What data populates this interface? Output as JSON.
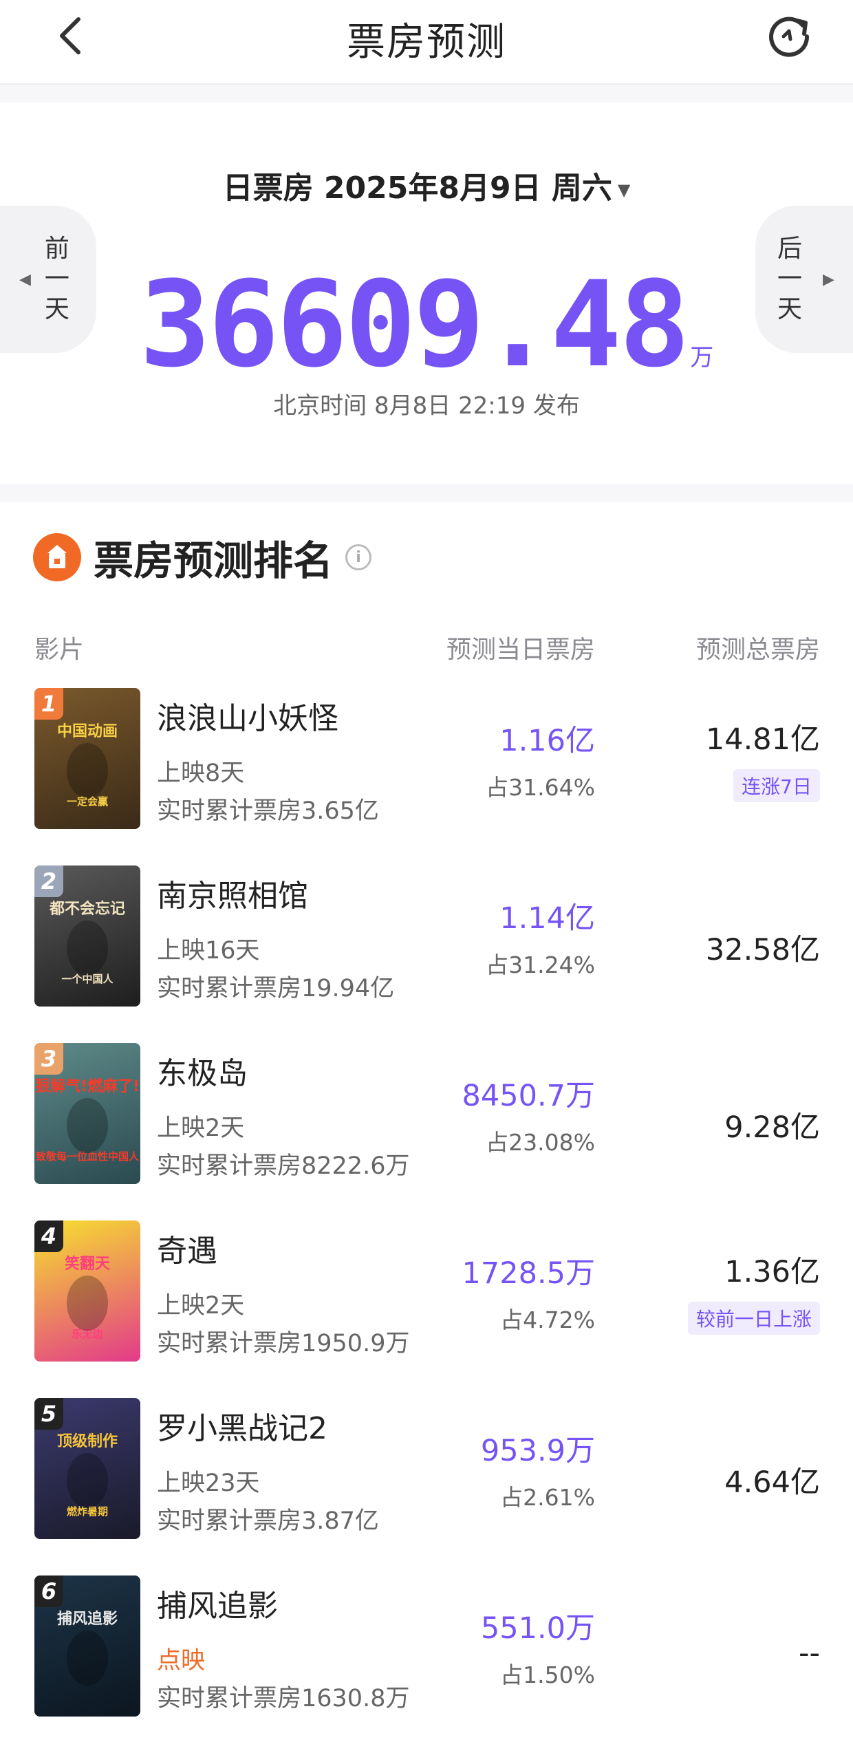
{
  "header": {
    "title": "票房预测",
    "back_icon": "chevron-left-icon",
    "refresh_icon": "refresh-icon"
  },
  "daily": {
    "date_label": "日票房 2025年8月9日 周六",
    "prev_label": [
      "前",
      "一",
      "天"
    ],
    "next_label": [
      "后",
      "一",
      "天"
    ],
    "value": "36609.48",
    "unit": "万",
    "published": "北京时间 8月8日 22:19 发布"
  },
  "ranking": {
    "title": "票房预测排名",
    "col_film": "影片",
    "col_day": "预测当日票房",
    "col_total": "预测总票房",
    "movies": [
      {
        "rank": "1",
        "name": "浪浪山小妖怪",
        "days": "上映8天",
        "cumulative": "实时累计票房3.65亿",
        "day_value": "1.16亿",
        "share": "占31.64%",
        "total": "14.81亿",
        "tag": "连涨7日",
        "badge_color": "#f07a3a",
        "poster_lines": [
          "中国动画",
          "一定会赢"
        ],
        "poster_colors": [
          "#7b5a2c",
          "#3a2a18"
        ],
        "poster_text_color": "#f7d046"
      },
      {
        "rank": "2",
        "name": "南京照相馆",
        "days": "上映16天",
        "cumulative": "实时累计票房19.94亿",
        "day_value": "1.14亿",
        "share": "占31.24%",
        "total": "32.58亿",
        "tag": "",
        "badge_color": "#9aa6b8",
        "poster_lines": [
          "都不会忘记",
          "一个中国人"
        ],
        "poster_colors": [
          "#5a5a5a",
          "#1e1e1e"
        ],
        "poster_text_color": "#f3e4c0"
      },
      {
        "rank": "3",
        "name": "东极岛",
        "days": "上映2天",
        "cumulative": "实时累计票房8222.6万",
        "day_value": "8450.7万",
        "share": "占23.08%",
        "total": "9.28亿",
        "tag": "",
        "badge_color": "#e8a26a",
        "poster_lines": [
          "狠解气!燃麻了!",
          "致敬每一位血性中国人"
        ],
        "poster_colors": [
          "#5f8a8a",
          "#2a4a4f"
        ],
        "poster_text_color": "#f53b2a"
      },
      {
        "rank": "4",
        "name": "奇遇",
        "days": "上映2天",
        "cumulative": "实时累计票房1950.9万",
        "day_value": "1728.5万",
        "share": "占4.72%",
        "total": "1.36亿",
        "tag": "较前一日上涨",
        "badge_color": "#222222",
        "poster_lines": [
          "笑翻天",
          "乐无边"
        ],
        "poster_colors": [
          "#f7e12e",
          "#e23a8a"
        ],
        "poster_text_color": "#ff3d7f"
      },
      {
        "rank": "5",
        "name": "罗小黑战记2",
        "days": "上映23天",
        "cumulative": "实时累计票房3.87亿",
        "day_value": "953.9万",
        "share": "占2.61%",
        "total": "4.64亿",
        "tag": "",
        "badge_color": "#222222",
        "poster_lines": [
          "顶级制作",
          "燃炸暑期"
        ],
        "poster_colors": [
          "#3c3a6e",
          "#1a1a2a"
        ],
        "poster_text_color": "#f5c53a"
      },
      {
        "rank": "6",
        "name": "捕风追影",
        "days": "点映",
        "cumulative": "实时累计票房1630.8万",
        "day_value": "551.0万",
        "share": "占1.50%",
        "total": "--",
        "tag": "",
        "badge_color": "#222222",
        "poster_lines": [
          "捕风追影",
          ""
        ],
        "poster_colors": [
          "#1d3447",
          "#0c1620"
        ],
        "poster_text_color": "#e8e8e8"
      }
    ]
  }
}
